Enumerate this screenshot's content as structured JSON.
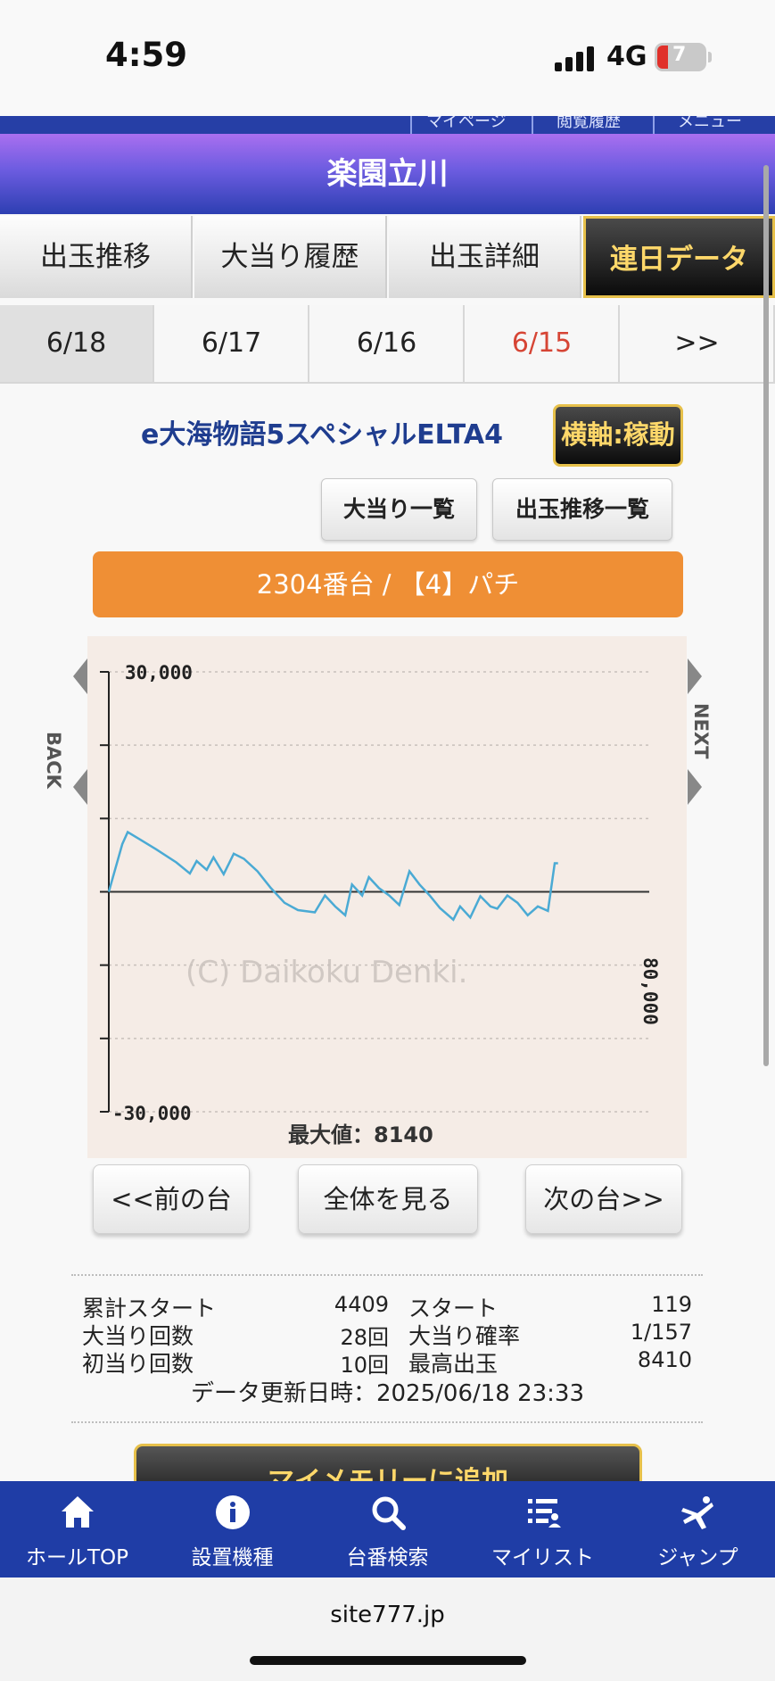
{
  "status": {
    "time": "4:59",
    "network": "4G",
    "battery": "7"
  },
  "top_strip": [
    "マイページ",
    "閲覧履歴",
    "メニュー"
  ],
  "header": {
    "title": "楽園立川"
  },
  "tabs": [
    {
      "label": "出玉推移"
    },
    {
      "label": "大当り履歴"
    },
    {
      "label": "出玉詳細"
    },
    {
      "label": "連日データ"
    }
  ],
  "dates": [
    {
      "label": "6/18"
    },
    {
      "label": "6/17"
    },
    {
      "label": "6/16"
    },
    {
      "label": "6/15"
    },
    {
      "label": ">>"
    }
  ],
  "machine": {
    "name": "e大海物語5スペシャルELTA4",
    "axis_button": "横軸:稼動",
    "buttons": {
      "jackpot_list": "大当り一覧",
      "trend_list": "出玉推移一覧"
    },
    "unit_bar": "2304番台 / 【4】パチ"
  },
  "chart_data": {
    "type": "line",
    "y_ticks": [
      "30,000",
      "-30,000"
    ],
    "ylim": [
      -30000,
      30000
    ],
    "xlim": [
      0,
      80000
    ],
    "x_max_label": "80,000",
    "back_label": "BACK",
    "next_label": "NEXT",
    "watermark": "(C) Daikoku Denki.",
    "max_value_text": "最大値：8140",
    "grid": true,
    "series": [
      {
        "color": "#4aaad4",
        "x": [
          0,
          2000,
          2800,
          4500,
          7000,
          10000,
          12000,
          13000,
          14500,
          15500,
          17000,
          18500,
          20000,
          22000,
          24000,
          26000,
          28000,
          30500,
          32000,
          33500,
          35000,
          36000,
          37500,
          38500,
          40000,
          41500,
          43000,
          44500,
          46000,
          47500,
          49000,
          51000,
          52000,
          53500,
          55000,
          56500,
          57500,
          59000,
          60500,
          62000,
          63500,
          65000,
          66000,
          66500
        ],
        "y": [
          0,
          6500,
          8140,
          7200,
          5800,
          4000,
          2500,
          4200,
          3000,
          4700,
          2400,
          5200,
          4500,
          2800,
          500,
          -1500,
          -2500,
          -2800,
          -500,
          -2000,
          -3200,
          1000,
          -500,
          2000,
          500,
          -500,
          -1800,
          2800,
          1000,
          -500,
          -2200,
          -3800,
          -2000,
          -3500,
          -600,
          -2000,
          -2300,
          -500,
          -1500,
          -3200,
          -2000,
          -2600,
          3900,
          3900
        ]
      }
    ]
  },
  "nav_buttons": {
    "prev": "<<前の台",
    "all": "全体を見る",
    "next": "次の台>>"
  },
  "stats": {
    "left": [
      {
        "label": "累計スタート",
        "value": "4409"
      },
      {
        "label": "大当り回数",
        "value": "28回"
      },
      {
        "label": "初当り回数",
        "value": "10回"
      }
    ],
    "right": [
      {
        "label": "スタート",
        "value": "119"
      },
      {
        "label": "大当り確率",
        "value": "1/157"
      },
      {
        "label": "最高出玉",
        "value": "8410"
      }
    ],
    "updated": "データ更新日時：2025/06/18 23:33"
  },
  "memory_button": "マイメモリーに追加",
  "bottom_nav": [
    {
      "label": "ホールTOP",
      "icon": "home-icon"
    },
    {
      "label": "設置機種",
      "icon": "info-icon"
    },
    {
      "label": "台番検索",
      "icon": "search-icon"
    },
    {
      "label": "マイリスト",
      "icon": "list-icon"
    },
    {
      "label": "ジャンプ",
      "icon": "jump-icon"
    }
  ],
  "url": "site777.jp",
  "colors": {
    "header_top": "#a96ff0",
    "header_bottom": "#2d3fb2",
    "accent_orange": "#ef8f35",
    "nav_blue": "#1f3da6",
    "gold": "#e6c04a",
    "line": "#4aaad4"
  }
}
